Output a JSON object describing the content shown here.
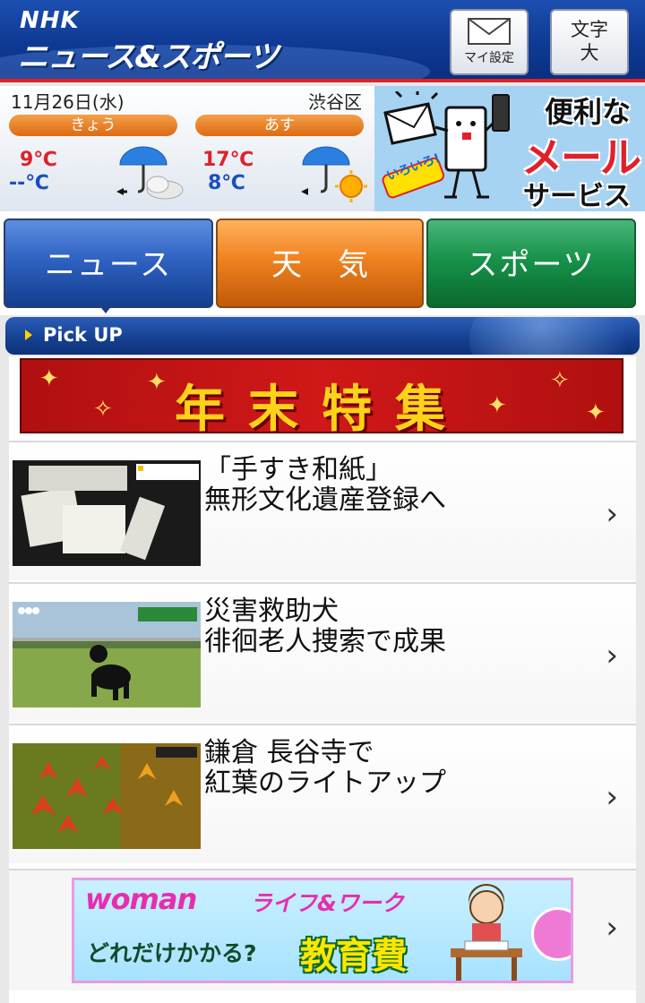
{
  "header": {
    "logo_top": "NHK",
    "logo_main": "ニュース&スポーツ",
    "settings_label": "マイ設定",
    "textsize_label_line1": "文字",
    "textsize_label_line2": "大",
    "accent_color": "#e0202a"
  },
  "weather": {
    "date": "11月26日(水)",
    "area": "渋谷区",
    "today": {
      "label": "きょう",
      "high": "9℃",
      "low": "--℃",
      "icon": "rain-cloud-icon"
    },
    "tomorrow": {
      "label": "あす",
      "high": "17℃",
      "low": "8℃",
      "icon": "rain-sun-icon"
    }
  },
  "mail_ad": {
    "line1": "便利な",
    "line2": "メール",
    "line3": "サービス",
    "tag": "いろいろ!"
  },
  "tabs": [
    {
      "label": "ニュース",
      "color": "#2f62c2"
    },
    {
      "label": "天気",
      "color": "#f08220"
    },
    {
      "label": "スポーツ",
      "color": "#17924a"
    }
  ],
  "pickup": {
    "label": "Pick UP"
  },
  "banner": {
    "title": "年末特集"
  },
  "news": [
    {
      "headline": "「手すき和紙」\n無形文化遺産登録へ"
    },
    {
      "headline": "災害救助犬\n徘徊老人捜索で成果"
    },
    {
      "headline": "鎌倉 長谷寺で\n紅葉のライトアップ"
    }
  ],
  "woman_ad": {
    "brand": "woman",
    "sub": "ライフ&ワーク",
    "question": "どれだけかかる?",
    "big": "教育費"
  },
  "chevron": "›"
}
